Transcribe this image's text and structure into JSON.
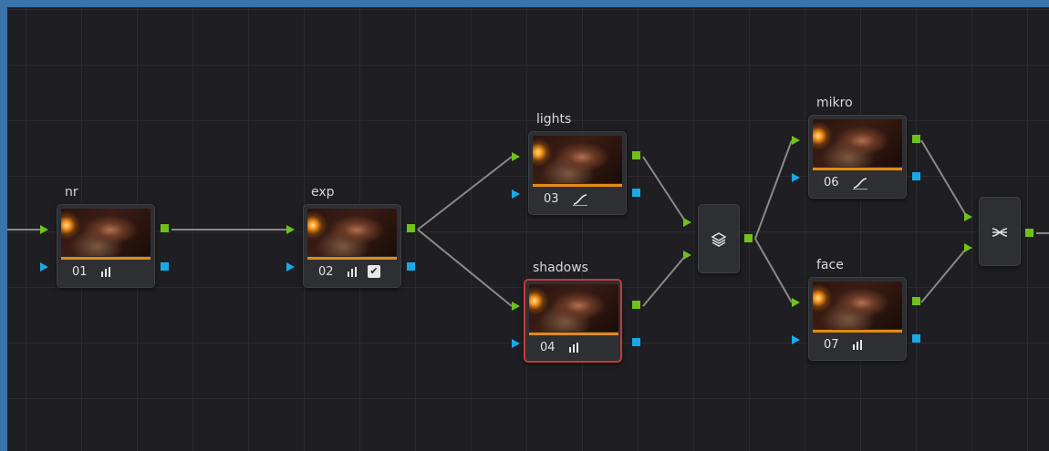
{
  "nodes": [
    {
      "label": "nr",
      "number": "01",
      "tool": "bars"
    },
    {
      "label": "exp",
      "number": "02",
      "tool": "bars-check"
    },
    {
      "label": "lights",
      "number": "03",
      "tool": "curve"
    },
    {
      "label": "shadows",
      "number": "04",
      "tool": "bars",
      "selected": true
    },
    {
      "label": "mikro",
      "number": "06",
      "tool": "curve"
    },
    {
      "label": "face",
      "number": "07",
      "tool": "bars"
    }
  ],
  "mixers": [
    {
      "icon": "layer-stack-icon"
    },
    {
      "icon": "parallel-mixer-icon"
    }
  ],
  "colors": {
    "canvas": "#1f1f23",
    "grid": "#2a2a2f",
    "node": "#2e2f33",
    "input_green": "#6fc21a",
    "input_blue": "#19a9e6",
    "bar_orange": "#e58a12",
    "selected_border": "#c23a3a",
    "frame": "#3a72aa"
  }
}
